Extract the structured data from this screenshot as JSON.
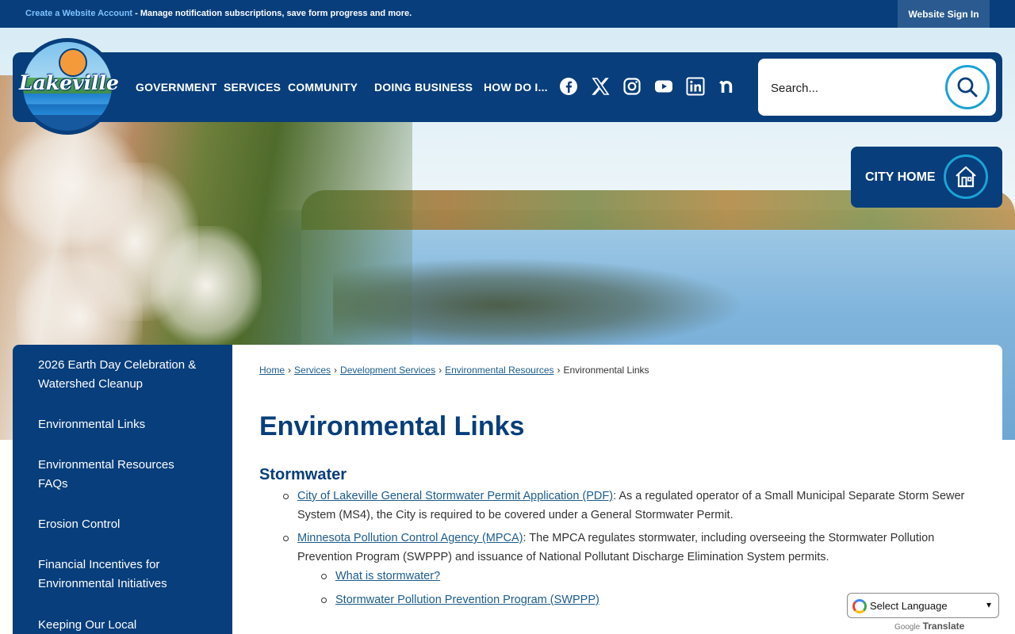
{
  "topbar": {
    "account_link": "Create a Website Account",
    "account_text": " - Manage notification subscriptions, save form progress and more.",
    "signin": "Website Sign In"
  },
  "logo": {
    "text": "Lakeville"
  },
  "nav": {
    "items": [
      "GOVERNMENT",
      "SERVICES",
      "COMMUNITY",
      "DOING BUSINESS",
      "HOW DO I..."
    ]
  },
  "social": [
    "facebook-icon",
    "x-twitter-icon",
    "instagram-icon",
    "youtube-icon",
    "linkedin-icon",
    "nextdoor-icon"
  ],
  "search": {
    "placeholder": "Search..."
  },
  "city_home": {
    "label": "CITY HOME"
  },
  "sidebar": {
    "items": [
      "2026 Earth Day Celebration & Watershed Cleanup",
      "Environmental Links",
      "Environmental Resources FAQs",
      "Erosion Control",
      "Financial Incentives for Environmental Initiatives",
      "Keeping Our Local"
    ]
  },
  "breadcrumb": {
    "links": [
      "Home",
      "Services",
      "Development Services",
      "Environmental Resources"
    ],
    "current": "Environmental Links"
  },
  "page": {
    "title": "Environmental Links",
    "section": "Stormwater",
    "items": [
      {
        "link": "City of Lakeville General Stormwater Permit Application (PDF)",
        "text": ": As a regulated operator of a Small Municipal Separate Storm Sewer System (MS4), the City is required to be covered under a General Stormwater Permit."
      },
      {
        "link": "Minnesota Pollution Control Agency (MPCA)",
        "text": ": The MPCA regulates stormwater, including overseeing the Stormwater Pollution Prevention Program (SWPPP) and issuance of National Pollutant Discharge Elimination System permits."
      }
    ],
    "subitems": [
      "What is stormwater?",
      "Stormwater Pollution Prevention Program (SWPPP)"
    ]
  },
  "translate": {
    "select": "Select Language",
    "powered_by": "Google",
    "translate": "Translate"
  },
  "colors": {
    "navy": "#083e7b",
    "accent": "#1aa3d6",
    "link": "#1d5c8e"
  }
}
